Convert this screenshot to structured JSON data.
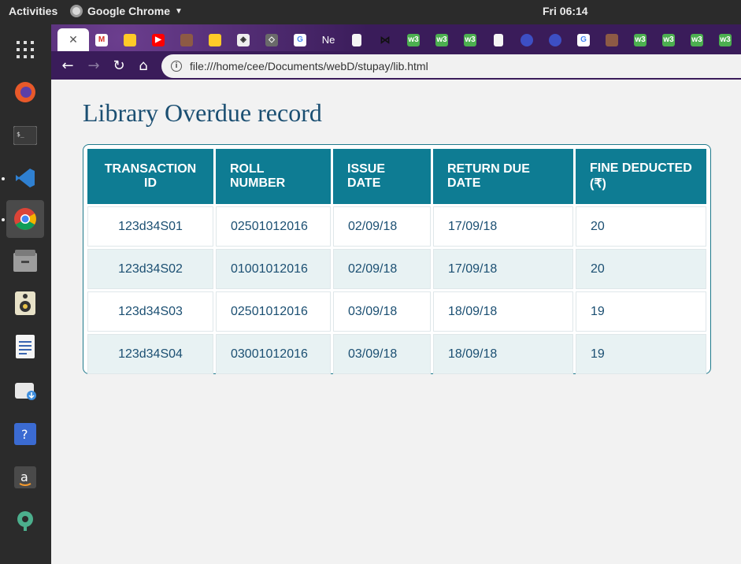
{
  "topbar": {
    "activities": "Activities",
    "app_name": "Google Chrome",
    "clock": "Fri 06:14"
  },
  "dock": {
    "items": [
      "apps-grid-icon",
      "firefox-icon",
      "terminal-icon",
      "vscode-icon",
      "chrome-icon",
      "files-icon",
      "rhythmbox-icon",
      "writer-icon",
      "software-icon",
      "help-icon",
      "amazon-icon",
      "settings-icon"
    ]
  },
  "tabs": {
    "fav_text_ne": "Ne"
  },
  "browser": {
    "url": "file:///home/cee/Documents/webD/stupay/lib.html"
  },
  "page": {
    "title": "Library Overdue record",
    "headers": [
      "TRANSACTION ID",
      "ROLL NUMBER",
      "ISSUE DATE",
      "RETURN DUE DATE",
      "FINE DEDUCTED (₹)"
    ],
    "rows": [
      [
        "123d34S01",
        "02501012016",
        "02/09/18",
        "17/09/18",
        "20"
      ],
      [
        "123d34S02",
        "01001012016",
        "02/09/18",
        "17/09/18",
        "20"
      ],
      [
        "123d34S03",
        "02501012016",
        "03/09/18",
        "18/09/18",
        "19"
      ],
      [
        "123d34S04",
        "03001012016",
        "03/09/18",
        "18/09/18",
        "19"
      ]
    ]
  }
}
